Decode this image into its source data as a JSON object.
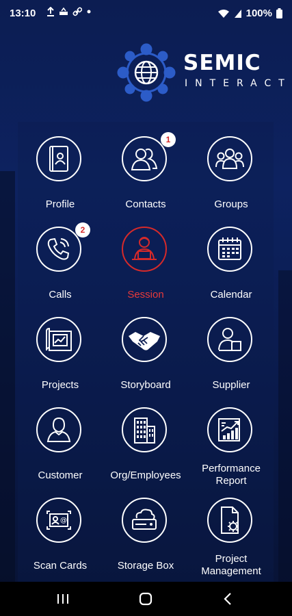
{
  "status": {
    "time": "13:10",
    "battery": "100%"
  },
  "logo": {
    "title": "SEMIC",
    "subtitle": "INTERACT"
  },
  "tiles": [
    {
      "label": "Profile",
      "icon": "profile-book-icon"
    },
    {
      "label": "Contacts",
      "icon": "contacts-icon",
      "badge": "1"
    },
    {
      "label": "Groups",
      "icon": "groups-icon"
    },
    {
      "label": "Calls",
      "icon": "phone-icon",
      "badge": "2"
    },
    {
      "label": "Session",
      "icon": "session-icon",
      "active": true,
      "active_color": "#e83a3a"
    },
    {
      "label": "Calendar",
      "icon": "calendar-icon"
    },
    {
      "label": "Projects",
      "icon": "blueprint-icon"
    },
    {
      "label": "Storyboard",
      "icon": "handshake-icon"
    },
    {
      "label": "Supplier",
      "icon": "supplier-icon"
    },
    {
      "label": "Customer",
      "icon": "customer-icon"
    },
    {
      "label": "Org/Employees",
      "icon": "building-icon"
    },
    {
      "label_line1": "Performance",
      "label_line2": "Report",
      "icon": "report-chart-icon"
    },
    {
      "label": "Scan Cards",
      "icon": "scan-card-icon"
    },
    {
      "label": "Storage Box",
      "icon": "cloud-storage-icon"
    },
    {
      "label_line1": "Project",
      "label_line2": "Management",
      "icon": "document-gear-icon"
    }
  ]
}
